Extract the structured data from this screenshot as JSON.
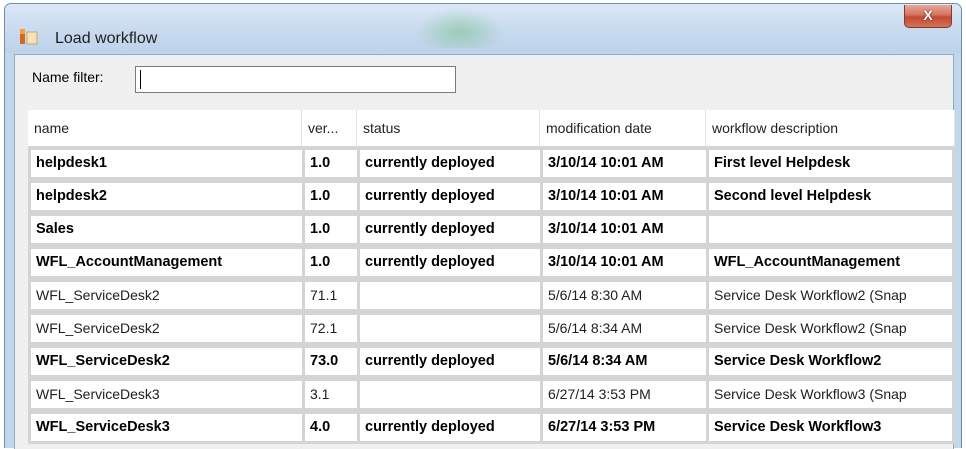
{
  "window": {
    "title": "Load workflow",
    "close_label": "X"
  },
  "filter": {
    "label": "Name filter:",
    "value": ""
  },
  "table": {
    "columns": [
      "name",
      "ver...",
      "status",
      "modification date",
      "workflow description"
    ],
    "rows": [
      {
        "bold": true,
        "cells": [
          "helpdesk1",
          "1.0",
          "currently deployed",
          "3/10/14 10:01 AM",
          "First level Helpdesk"
        ]
      },
      {
        "bold": true,
        "cells": [
          "helpdesk2",
          "1.0",
          "currently deployed",
          "3/10/14 10:01 AM",
          "Second level Helpdesk"
        ]
      },
      {
        "bold": true,
        "cells": [
          "Sales",
          "1.0",
          "currently deployed",
          "3/10/14 10:01 AM",
          ""
        ]
      },
      {
        "bold": true,
        "cells": [
          "WFL_AccountManagement",
          "1.0",
          "currently deployed",
          "3/10/14 10:01 AM",
          "WFL_AccountManagement"
        ]
      },
      {
        "bold": false,
        "cells": [
          "WFL_ServiceDesk2",
          "71.1",
          "",
          "5/6/14 8:30 AM",
          "Service Desk Workflow2 (Snap"
        ]
      },
      {
        "bold": false,
        "cells": [
          "WFL_ServiceDesk2",
          "72.1",
          "",
          "5/6/14 8:34 AM",
          "Service Desk Workflow2 (Snap"
        ]
      },
      {
        "bold": true,
        "cells": [
          "WFL_ServiceDesk2",
          "73.0",
          "currently deployed",
          "5/6/14 8:34 AM",
          "Service Desk Workflow2"
        ]
      },
      {
        "bold": false,
        "cells": [
          "WFL_ServiceDesk3",
          "3.1",
          "",
          "6/27/14 3:53 PM",
          "Service Desk Workflow3 (Snap"
        ]
      },
      {
        "bold": true,
        "cells": [
          "WFL_ServiceDesk3",
          "4.0",
          "currently deployed",
          "6/27/14 3:53 PM",
          "Service Desk Workflow3"
        ]
      }
    ]
  },
  "colors": {
    "frame": "#c3d7ec",
    "close_button": "#c24a32",
    "client_background": "#f0f0f0",
    "cell_border": "#d4d4d4"
  },
  "icons": {
    "app": "workflow-app-icon",
    "close": "close-icon"
  }
}
